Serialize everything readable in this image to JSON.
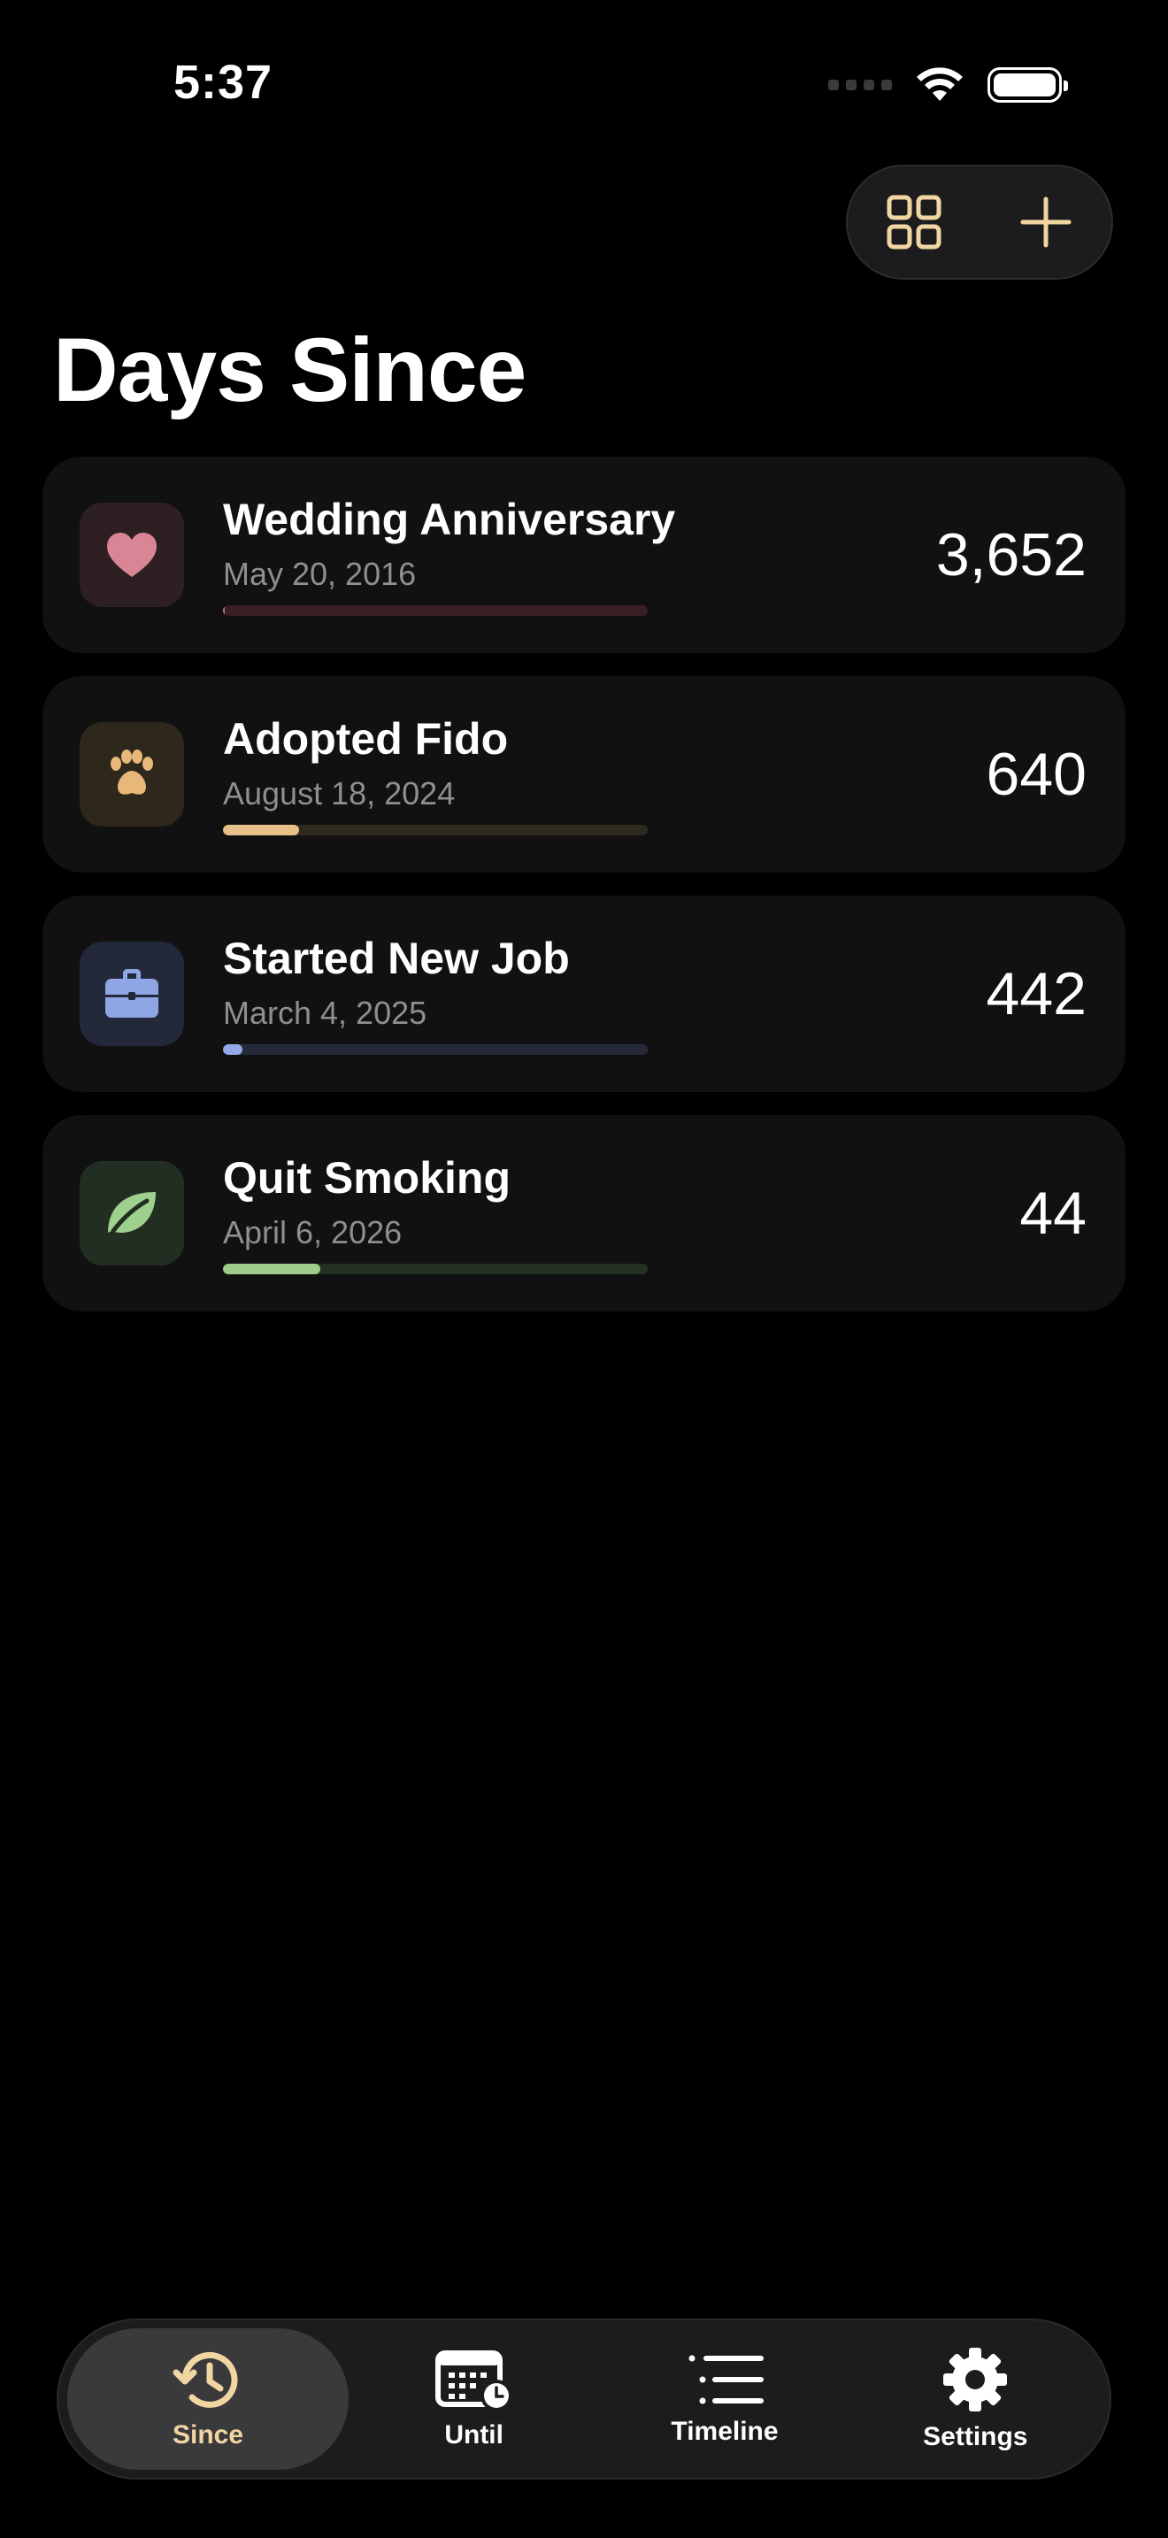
{
  "status_bar": {
    "time": "5:37"
  },
  "header": {
    "title": "Days Since"
  },
  "colors": {
    "accent": "#f2d6a2",
    "background": "#000000",
    "card": "#111111"
  },
  "events": [
    {
      "title": "Wedding Anniversary",
      "date": "May 20, 2016",
      "count": "3,652",
      "icon": "heart-icon",
      "icon_color": "#d98596",
      "icon_bg": "#2e1f22",
      "progress": 0.005,
      "progress_color": "#c2707e",
      "track_color": "#3a1f24"
    },
    {
      "title": "Adopted Fido",
      "date": "August 18, 2024",
      "count": "640",
      "icon": "paw-icon",
      "icon_color": "#e8b87a",
      "icon_bg": "#2e271c",
      "progress": 0.18,
      "progress_color": "#e8c08a",
      "track_color": "#2e2a1e"
    },
    {
      "title": "Started New Job",
      "date": "March 4, 2025",
      "count": "442",
      "icon": "briefcase-icon",
      "icon_color": "#8ea6e3",
      "icon_bg": "#23283a",
      "progress": 0.045,
      "progress_color": "#93a8e6",
      "track_color": "#262a38"
    },
    {
      "title": "Quit Smoking",
      "date": "April 6, 2026",
      "count": "44",
      "icon": "leaf-icon",
      "icon_color": "#9fd08e",
      "icon_bg": "#232e22",
      "progress": 0.23,
      "progress_color": "#9fcc8a",
      "track_color": "#243024"
    }
  ],
  "tabs": [
    {
      "label": "Since",
      "icon": "history-icon",
      "active": true
    },
    {
      "label": "Until",
      "icon": "calendar-clock-icon",
      "active": false
    },
    {
      "label": "Timeline",
      "icon": "list-icon",
      "active": false
    },
    {
      "label": "Settings",
      "icon": "gear-icon",
      "active": false
    }
  ]
}
